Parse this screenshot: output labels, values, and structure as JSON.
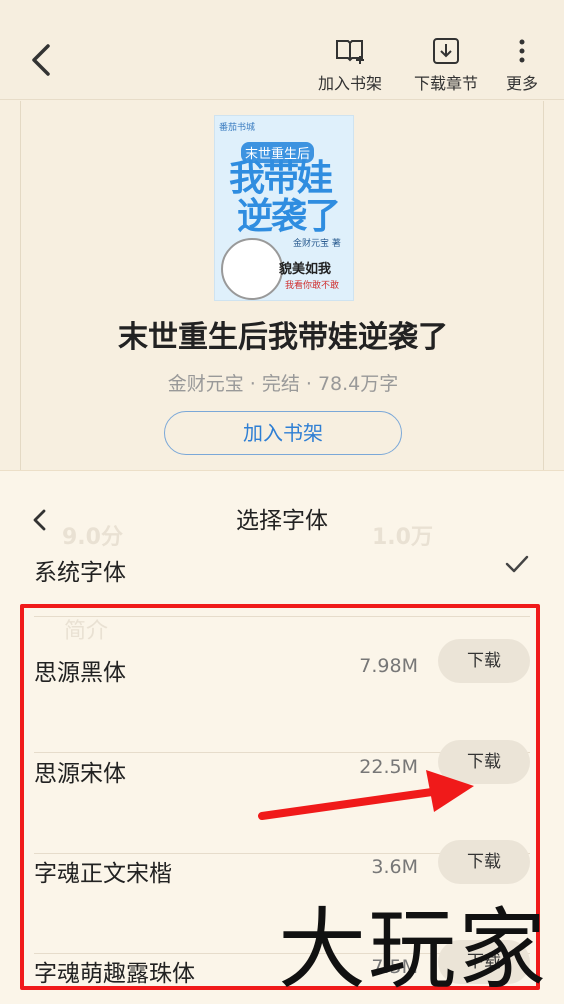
{
  "topbar": {
    "add_shelf": "加入书架",
    "download": "下载章节",
    "more": "更多"
  },
  "book": {
    "title": "末世重生后我带娃逆袭了",
    "meta": "金财元宝 · 完结 · 78.4万字",
    "add_shelf_button": "加入书架",
    "cover": {
      "publisher": "番茄书城",
      "tagline": "末世重生后",
      "title_line1": "我带娃",
      "title_line2": "逆袭了",
      "author": "金财元宝 著",
      "slogan": "貌美如我",
      "slogan_sub": "我看你敢不敢"
    }
  },
  "font_panel": {
    "title": "选择字体",
    "system_font": "系统字体",
    "fonts": [
      {
        "name": "思源黑体",
        "size": "7.98M",
        "action": "下载"
      },
      {
        "name": "思源宋体",
        "size": "22.5M",
        "action": "下载"
      },
      {
        "name": "字魂正文宋楷",
        "size": "3.6M",
        "action": "下载"
      },
      {
        "name": "字魂萌趣露珠体",
        "size": "7.5M",
        "action": "下载"
      }
    ]
  },
  "background_ghost": {
    "score": "9.0分",
    "readers": "1.0万",
    "intro": "简介"
  },
  "watermark": "大玩家",
  "colors": {
    "annotation_red": "#f01a1a",
    "accent_blue": "#2f7fd4",
    "panel_bg": "#fbf5e9"
  }
}
